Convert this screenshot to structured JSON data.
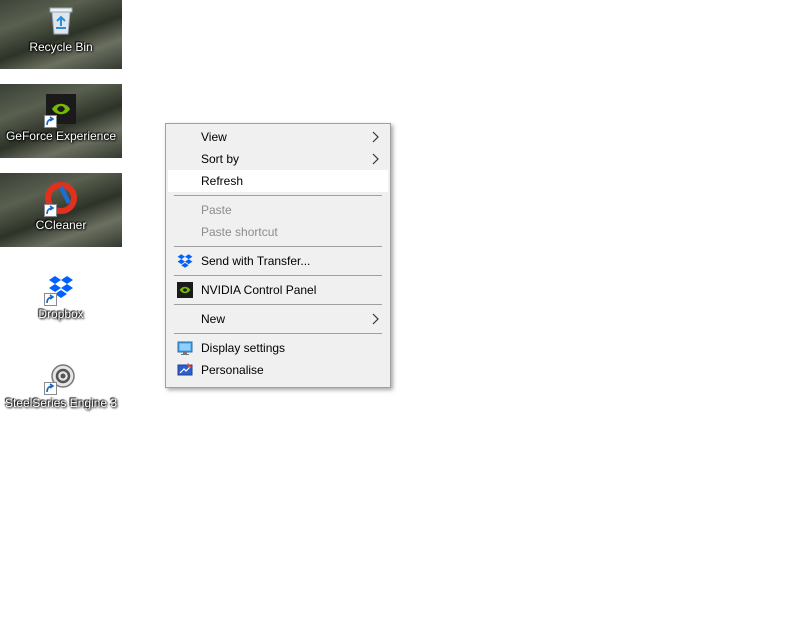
{
  "desktop": {
    "icons": [
      {
        "label": "Recycle Bin",
        "icon": "recycle-bin-icon"
      },
      {
        "label": "GeForce Experience",
        "icon": "nvidia-icon"
      },
      {
        "label": "CCleaner",
        "icon": "ccleaner-icon"
      },
      {
        "label": "Dropbox",
        "icon": "dropbox-icon"
      },
      {
        "label": "SteelSeries Engine 3",
        "icon": "steelseries-icon"
      }
    ]
  },
  "context_menu": {
    "items": [
      {
        "label": "View",
        "submenu": true
      },
      {
        "label": "Sort by",
        "submenu": true
      },
      {
        "label": "Refresh",
        "hovered": true
      },
      {
        "label": "Paste",
        "disabled": true
      },
      {
        "label": "Paste shortcut",
        "disabled": true
      },
      {
        "label": "Send with Transfer...",
        "icon": "dropbox-icon"
      },
      {
        "label": "NVIDIA Control Panel",
        "icon": "nvidia-icon"
      },
      {
        "label": "New",
        "submenu": true
      },
      {
        "label": "Display settings",
        "icon": "display-icon"
      },
      {
        "label": "Personalise",
        "icon": "personalise-icon"
      }
    ]
  },
  "colors": {
    "menu_bg": "#f0f0f0",
    "menu_hover": "#ffffff",
    "disabled_text": "#8c8c8c",
    "nvidia_green": "#76b900",
    "dropbox_blue": "#0061fe"
  }
}
